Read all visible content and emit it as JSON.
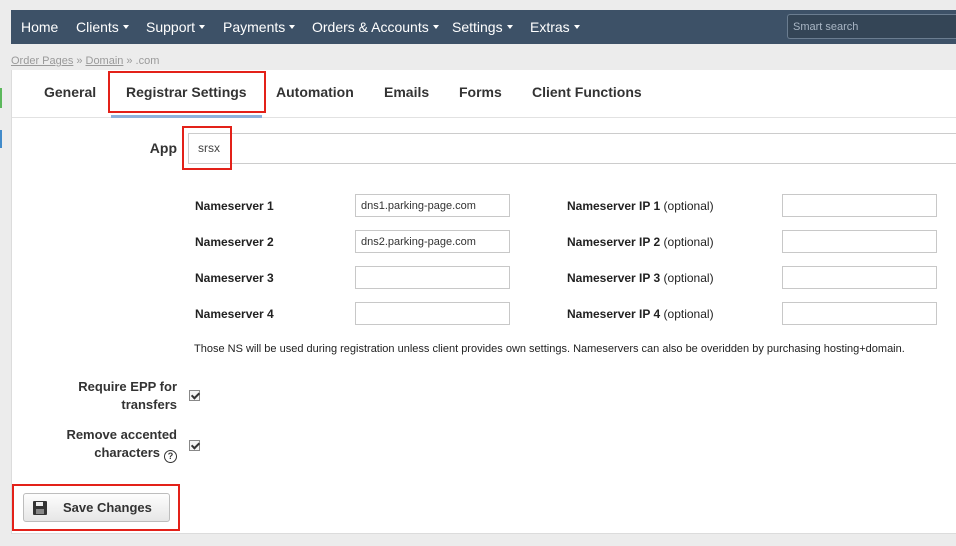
{
  "nav": {
    "items": [
      {
        "label": "Home",
        "caret": false
      },
      {
        "label": "Clients",
        "caret": true
      },
      {
        "label": "Support",
        "caret": true
      },
      {
        "label": "Payments",
        "caret": true
      },
      {
        "label": "Orders & Accounts",
        "caret": true
      },
      {
        "label": "Settings",
        "caret": true
      },
      {
        "label": "Extras",
        "caret": true
      }
    ],
    "search_placeholder": "Smart search"
  },
  "breadcrumb": {
    "items": [
      "Order Pages",
      "Domain",
      ".com"
    ],
    "separator": "»"
  },
  "tabs": [
    {
      "label": "General",
      "active": false
    },
    {
      "label": "Registrar Settings",
      "active": true
    },
    {
      "label": "Automation",
      "active": false
    },
    {
      "label": "Emails",
      "active": false
    },
    {
      "label": "Forms",
      "active": false
    },
    {
      "label": "Client Functions",
      "active": false
    }
  ],
  "app": {
    "label": "App",
    "value": "srsx"
  },
  "nameservers": [
    {
      "label": "Nameserver 1",
      "value": "dns1.parking-page.com",
      "ip_label": "Nameserver IP 1",
      "ip_optional": "(optional)",
      "ip_value": ""
    },
    {
      "label": "Nameserver 2",
      "value": "dns2.parking-page.com",
      "ip_label": "Nameserver IP 2",
      "ip_optional": "(optional)",
      "ip_value": ""
    },
    {
      "label": "Nameserver 3",
      "value": "",
      "ip_label": "Nameserver IP 3",
      "ip_optional": "(optional)",
      "ip_value": ""
    },
    {
      "label": "Nameserver 4",
      "value": "",
      "ip_label": "Nameserver IP 4",
      "ip_optional": "(optional)",
      "ip_value": ""
    }
  ],
  "ns_note": "Those NS will be used during registration unless client provides own settings. Nameservers can also be overidden by purchasing hosting+domain.",
  "options": {
    "require_epp": {
      "line1": "Require EPP for",
      "line2": "transfers",
      "checked": true
    },
    "remove_accented": {
      "line1": "Remove accented",
      "line2": "characters",
      "checked": true,
      "help_icon": "question-circle-icon"
    }
  },
  "save_button": {
    "label": "Save Changes",
    "icon": "floppy-disk-icon"
  },
  "colors": {
    "navbar": "#3d5167",
    "highlight": "#e32119",
    "active_tab_underline": "#8db2dc"
  }
}
